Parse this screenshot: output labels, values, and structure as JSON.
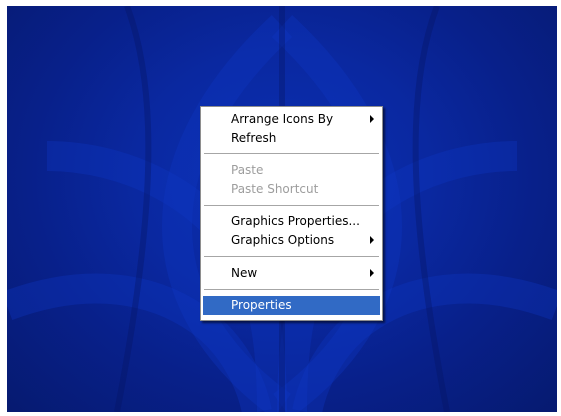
{
  "desktop": {
    "background_color": "#0a28a0",
    "pattern_color": "#0d35c2"
  },
  "context_menu": {
    "items": [
      {
        "label": "Arrange Icons By",
        "submenu": true,
        "enabled": true
      },
      {
        "label": "Refresh",
        "submenu": false,
        "enabled": true
      },
      {
        "label": "Paste",
        "submenu": false,
        "enabled": false
      },
      {
        "label": "Paste Shortcut",
        "submenu": false,
        "enabled": false
      },
      {
        "label": "Graphics Properties...",
        "submenu": false,
        "enabled": true
      },
      {
        "label": "Graphics Options",
        "submenu": true,
        "enabled": true
      },
      {
        "label": "New",
        "submenu": true,
        "enabled": true
      },
      {
        "label": "Properties",
        "submenu": false,
        "enabled": true,
        "selected": true
      }
    ],
    "highlight_color": "#316ac5"
  }
}
